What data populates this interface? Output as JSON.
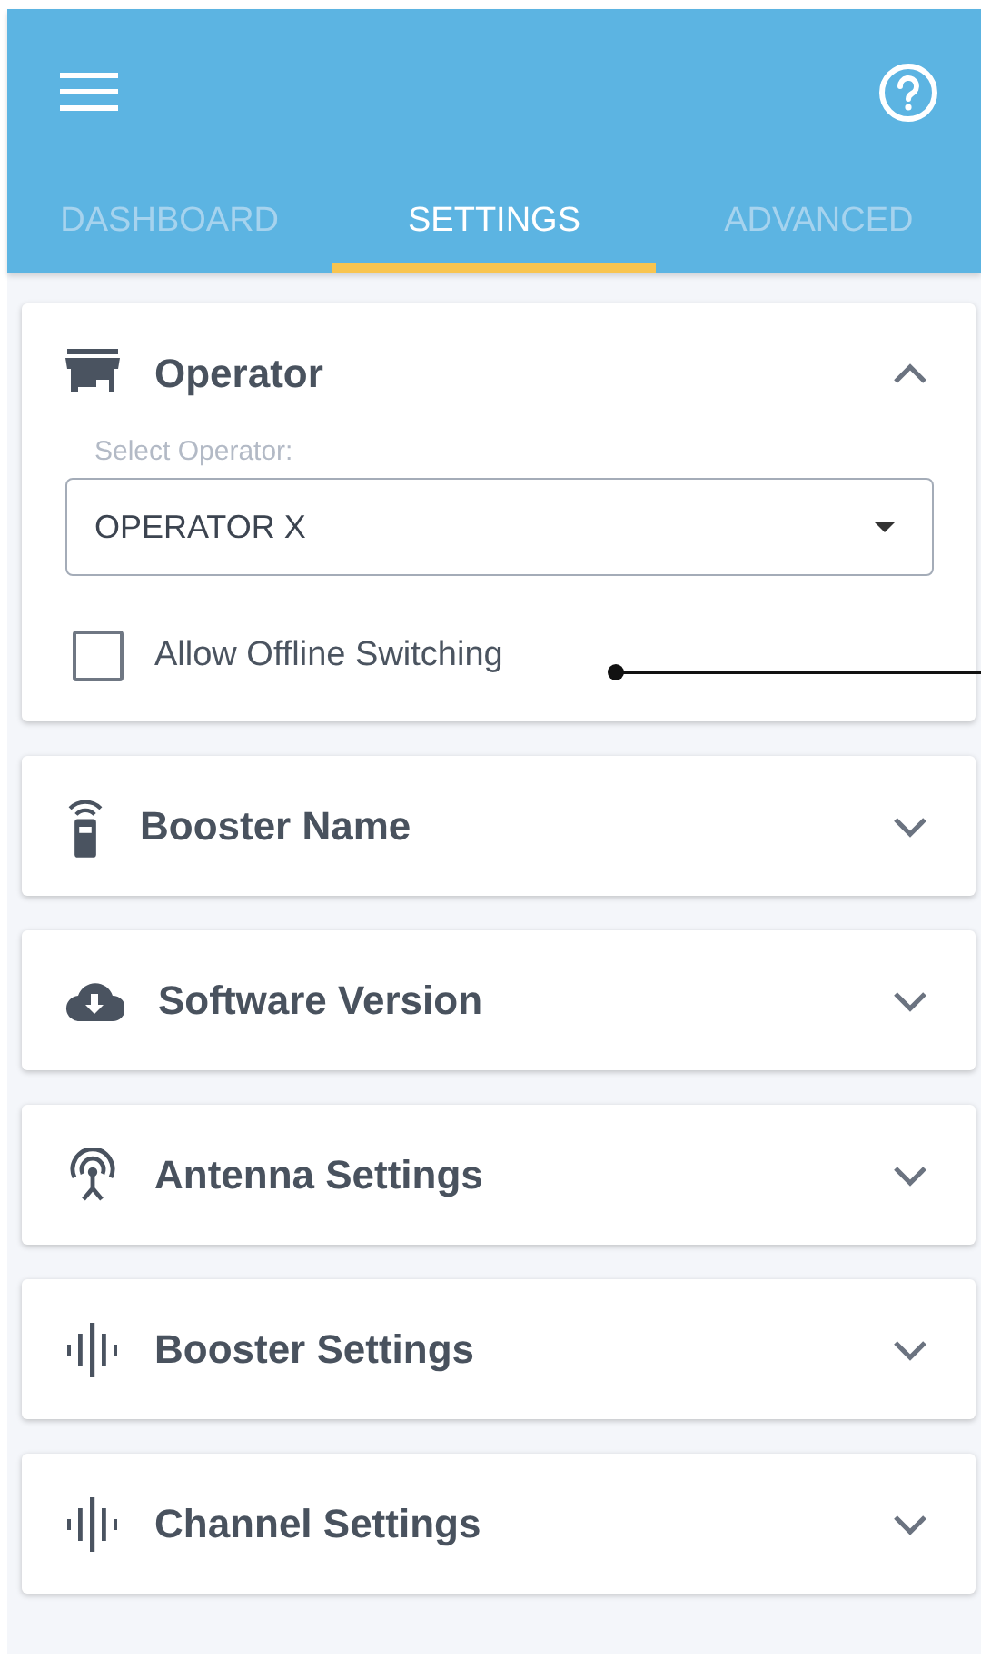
{
  "tabs": [
    {
      "label": "DASHBOARD",
      "selected": false
    },
    {
      "label": "SETTINGS",
      "selected": true
    },
    {
      "label": "ADVANCED",
      "selected": false
    }
  ],
  "sections": [
    {
      "title": "Operator",
      "expanded": true,
      "select_label": "Select Operator:",
      "select_value": "OPERATOR X",
      "checkbox": {
        "label": "Allow Offline Switching",
        "checked": false
      }
    },
    {
      "title": "Booster Name",
      "expanded": false
    },
    {
      "title": "Software Version",
      "expanded": false
    },
    {
      "title": "Antenna Settings",
      "expanded": false
    },
    {
      "title": "Booster Settings",
      "expanded": false
    },
    {
      "title": "Channel Settings",
      "expanded": false
    }
  ]
}
